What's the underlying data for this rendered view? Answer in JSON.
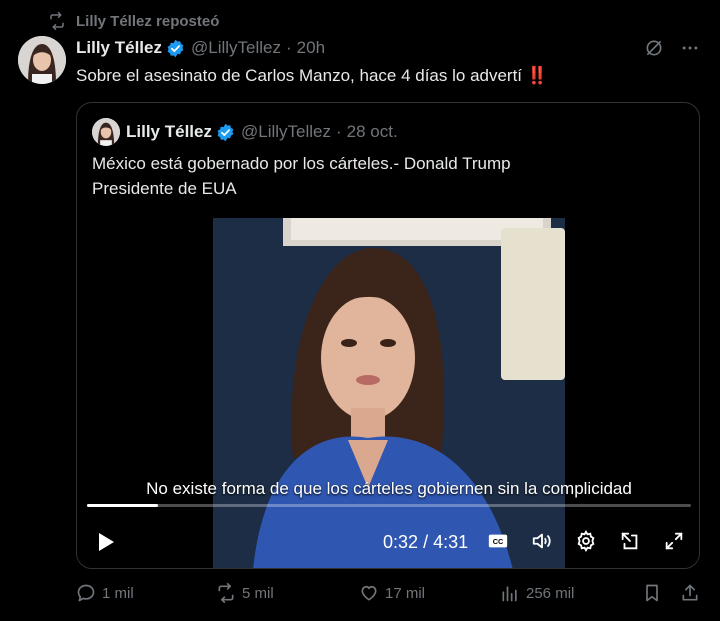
{
  "repost": {
    "label": "Lilly Téllez reposteó",
    "icon": "repost-icon"
  },
  "post": {
    "author_name": "Lilly Téllez",
    "handle": "@LillyTellez",
    "separator": "·",
    "time": "20h",
    "text": "Sobre el asesinato de Carlos Manzo, hace 4 días lo advertí",
    "emoji": "‼️"
  },
  "quote": {
    "author_name": "Lilly Téllez",
    "handle": "@LillyTellez",
    "separator": "·",
    "date": "28 oct.",
    "text_line1": "México está gobernado por los cárteles.- Donald Trump",
    "text_line2": "Presidente de EUA"
  },
  "video": {
    "caption": "No existe forma de que los cárteles gobiernen sin la complicidad",
    "current_time": "0:32",
    "separator": "/",
    "duration": "4:31",
    "progress_fraction": 0.118
  },
  "actions": {
    "replies": "1 mil",
    "reposts": "5 mil",
    "likes": "17 mil",
    "views": "256 mil"
  },
  "colors": {
    "background": "#000000",
    "text": "#e7e9ea",
    "muted": "#71767b",
    "verified": "#1d9bf0",
    "border": "#2f3336"
  }
}
